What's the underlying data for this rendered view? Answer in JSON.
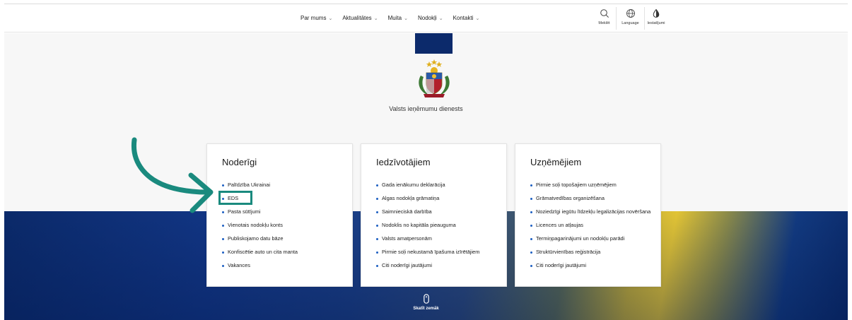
{
  "nav": {
    "menu": [
      {
        "label": "Par mums"
      },
      {
        "label": "Aktualitātes"
      },
      {
        "label": "Muita"
      },
      {
        "label": "Nodokļi"
      },
      {
        "label": "Kontakti"
      }
    ],
    "tools": {
      "search": {
        "label": "Meklēt",
        "icon": "search-icon"
      },
      "language": {
        "label": "Language",
        "icon": "globe-icon"
      },
      "settings": {
        "label": "Iestatījumi",
        "icon": "contrast-drop-icon"
      }
    }
  },
  "hero": {
    "agency_name": "Valsts ieņēmumu dienests",
    "emblem": "latvia-coat-of-arms"
  },
  "cards": [
    {
      "title": "Noderīgi",
      "items": [
        "Palīdzība Ukrainai",
        "EDS",
        "Pasta sūtījumi",
        "Vienotais nodokļu konts",
        "Publiskojamo datu bāze",
        "Konfiscētie auto un cita manta",
        "Vakances"
      ]
    },
    {
      "title": "Iedzīvotājiem",
      "items": [
        "Gada ienākumu deklarācija",
        "Algas nodokļa grāmatiņa",
        "Saimnieciskā darbība",
        "Nodoklis no kapitāla pieauguma",
        "Valsts amatpersonām",
        "Pirmie soļi nekustamā īpašuma izīrētājiem",
        "Citi noderīgi jautājumi"
      ]
    },
    {
      "title": "Uzņēmējiem",
      "items": [
        "Pirmie soļi topošajiem uzņēmējiem",
        "Grāmatvedības organizēšana",
        "Noziedzīgi iegūtu līdzekļu legalizācijas novēršana",
        "Licences un atļaujas",
        "Termiņpagarinājumi un nodokļu parādi",
        "Struktūrvienības reģistrācija",
        "Citi noderīgi jautājumi"
      ]
    }
  ],
  "annotation": {
    "arrow_color": "#1a8a7e",
    "highlighted_item": "EDS"
  },
  "scroll_hint": {
    "label": "Skatīt zemāk",
    "icon": "mouse-icon"
  },
  "colors": {
    "accent_blue": "#1d5fc2",
    "flag_navy": "#0c2a6b",
    "annotation_teal": "#1a8a7e"
  }
}
